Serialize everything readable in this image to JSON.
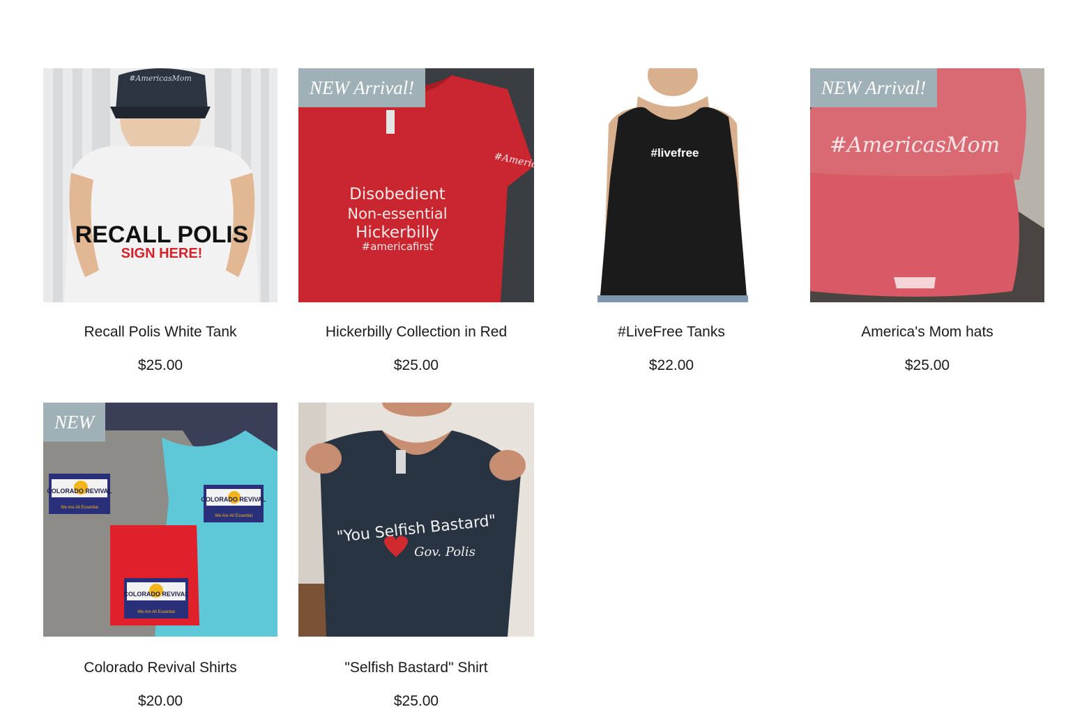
{
  "products": [
    {
      "title": "Recall Polis White Tank",
      "price": "$25.00",
      "ribbon": "",
      "print": [
        "RECALL POLIS",
        "SIGN HERE!"
      ],
      "hat_text": "#AmericasMom"
    },
    {
      "title": "Hickerbilly Collection in Red",
      "price": "$25.00",
      "ribbon": "NEW Arrival!",
      "print": [
        "Disobedient",
        "Non-essential",
        "Hickerbilly",
        "#americafirst"
      ],
      "sleeve_text": "#AmericasMom"
    },
    {
      "title": "#LiveFree Tanks",
      "price": "$22.00",
      "ribbon": "",
      "print": [
        "#livefree"
      ]
    },
    {
      "title": "America's Mom hats",
      "price": "$25.00",
      "ribbon": "NEW Arrival!",
      "print": [
        "#AmericasMom"
      ]
    },
    {
      "title": "Colorado Revival Shirts",
      "price": "$20.00",
      "ribbon": "NEW",
      "print": [
        "COLORADO REVIVAL",
        "We Are All Essential"
      ]
    },
    {
      "title": "\"Selfish Bastard\" Shirt",
      "price": "$25.00",
      "ribbon": "",
      "print": [
        "\"You Selfish Bastard\"",
        "Gov. Polis"
      ]
    }
  ],
  "colors": {
    "ribbon_bg": "#9fb1b6",
    "text": "#1a1a1a"
  }
}
